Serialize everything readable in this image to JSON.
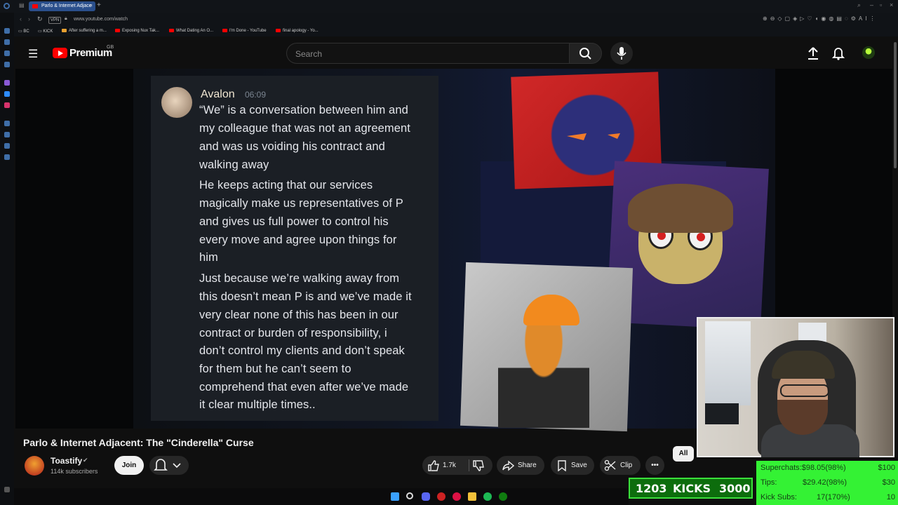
{
  "browser": {
    "tab_title": "Parlo & Internet Adjace",
    "url": "www.youtube.com/watch",
    "vpn_label": "VPN",
    "bookmarks": [
      {
        "label": "BC"
      },
      {
        "label": "KICK"
      },
      {
        "label": "After suffering a m..."
      },
      {
        "label": "Exposing Nux Tak..."
      },
      {
        "label": "What Dating An O..."
      },
      {
        "label": "I'm Done - YouTube"
      },
      {
        "label": "final apology - Yo..."
      }
    ]
  },
  "header": {
    "brand": "Premium",
    "region": "GB",
    "search_placeholder": "Search"
  },
  "video_overlay": {
    "discord_name": "Avalon",
    "discord_time": "06:09",
    "lines": [
      "“We” is a conversation between him and",
      "my colleague that was not an agreement",
      "and was us voiding his contract and",
      "walking away",
      "He keeps acting that our services",
      "magically make us representatives of P",
      "and gives us full power to control his",
      "every move and agree upon things for",
      "him",
      "Just because we’re walking away from",
      "this doesn’t mean P is and we’ve made it",
      "very clear none of this has been in our",
      "contract or burden of responsibility, i",
      "don’t control my clients and don’t speak",
      "for them but he can’t seem to",
      "comprehend that even after we’ve made",
      "it clear multiple times.."
    ]
  },
  "video": {
    "title": "Parlo & Internet Adjacent: The \"Cinderella\" Curse",
    "channel": "Toastify",
    "subscribers": "114k subscribers",
    "join_label": "Join",
    "likes": "1.7k",
    "share_label": "Share",
    "save_label": "Save",
    "clip_label": "Clip",
    "chip_all": "All"
  },
  "kicks": {
    "current": "1203",
    "label": "KICKS",
    "goal": "3000"
  },
  "goals": [
    {
      "label": "Superchats:",
      "value": "$98.05(98%)",
      "target": "$100"
    },
    {
      "label": "Tips:",
      "value": "$29.42(98%)",
      "target": "$30"
    },
    {
      "label": "Kick Subs:",
      "value": "17(170%)",
      "target": "10"
    }
  ],
  "colors": {
    "yt_red": "#ff0000",
    "overlay_green": "#34f234",
    "kicks_green": "#0d6d0d"
  }
}
